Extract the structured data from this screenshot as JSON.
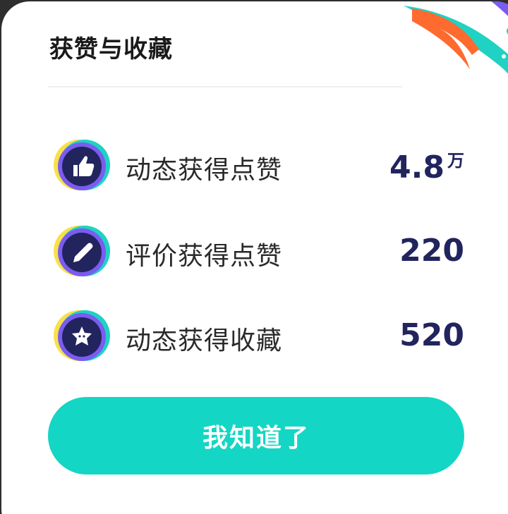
{
  "dialog": {
    "title": "获赞与收藏",
    "rows": [
      {
        "label": "动态获得点赞",
        "value": "4.8",
        "unit": "万",
        "icon": "thumbs-up-icon"
      },
      {
        "label": "评价获得点赞",
        "value": "220",
        "unit": "",
        "icon": "pen-icon"
      },
      {
        "label": "动态获得收藏",
        "value": "520",
        "unit": "",
        "icon": "star-icon"
      }
    ],
    "button_label": "我知道了"
  },
  "colors": {
    "accent": "#14d6c4",
    "value": "#22245e",
    "icon_bg": "#22245e",
    "icon_ring_teal": "#1fd2c3",
    "icon_ring_yellow": "#f7e04a",
    "icon_ring_purple": "#7a5cf0",
    "deco_orange": "#ff6a2f"
  }
}
